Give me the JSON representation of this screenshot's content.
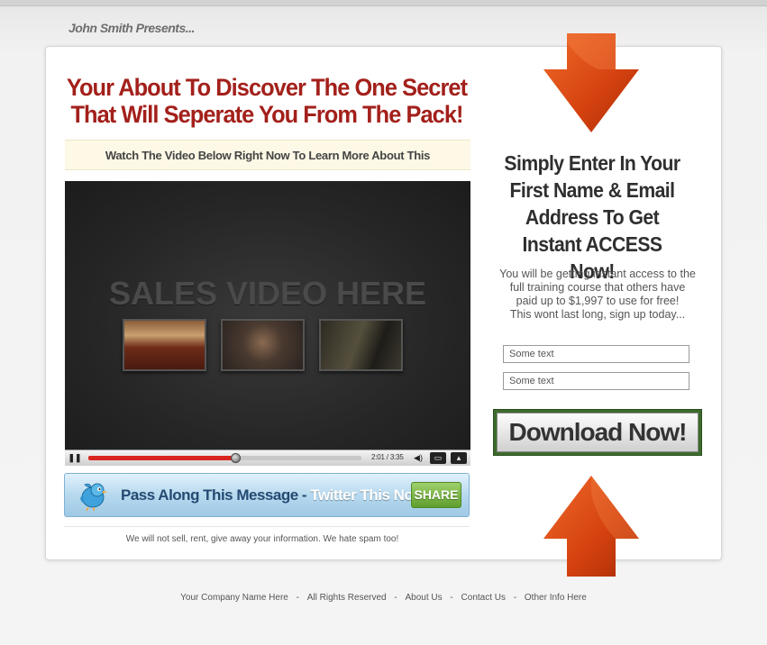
{
  "header": {
    "presenter": "John Smith Presents..."
  },
  "main": {
    "headline_line1": "Your About To Discover The One Secret",
    "headline_line2": "That Will Seperate You From The Pack!",
    "subheadline": "Watch The Video Below Right Now To Learn More About This",
    "video": {
      "placeholder_title": "SALES VIDEO HERE",
      "time": "2:01 / 3:35",
      "progress": 0.54
    },
    "share": {
      "message": "Pass Along This Message",
      "separator": " - ",
      "twitter_text": "Twitter This Now!",
      "button_label": "SHARE"
    },
    "privacy_note": "We will not sell, rent, give away your information. We hate spam too!"
  },
  "optin": {
    "heading": "Simply Enter In Your First Name & Email Address To Get Instant ACCESS Now!",
    "body_line1": "You will be getting instant access to the",
    "body_line2": "full training course that others have",
    "body_line3": "paid up to $1,997 to use for free!",
    "body_line4": "This wont last long, sign up today...",
    "field1_value": "Some text",
    "field2_value": "Some text",
    "download_label": "Download Now!"
  },
  "footer": {
    "company": "Your Company Name Here",
    "rights": "All Rights Reserved",
    "about": "About Us",
    "contact": "Contact Us",
    "other": "Other Info Here",
    "sep": "-"
  },
  "colors": {
    "headline": "#a3201b",
    "arrow": "#d94a12",
    "download_border": "#3d6b2c",
    "share_button": "#6aa83a"
  },
  "icons": [
    "twitter-bird-icon",
    "arrow-down-icon",
    "arrow-up-icon",
    "pause-icon",
    "volume-icon",
    "fullscreen-icon"
  ]
}
